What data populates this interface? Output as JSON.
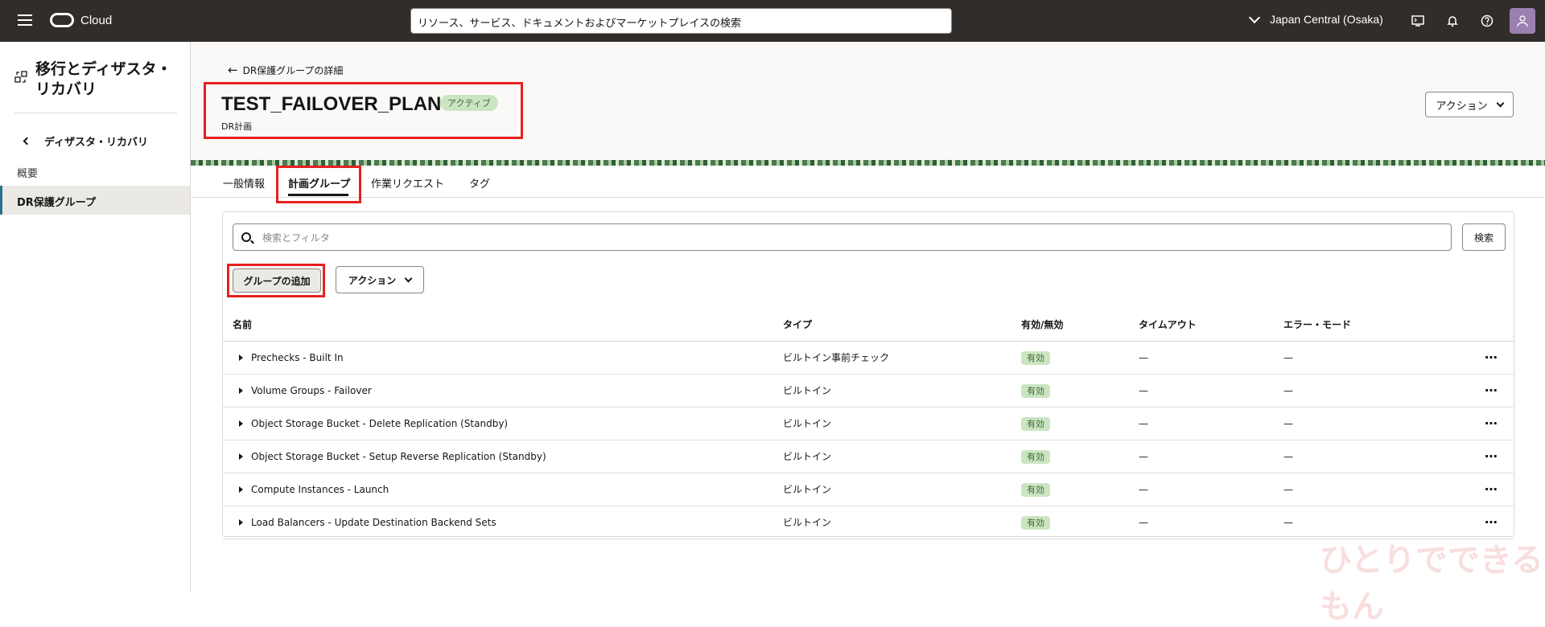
{
  "topbar": {
    "logo_text": "Cloud",
    "search_placeholder": "リソース、サービス、ドキュメントおよびマーケットプレイスの検索",
    "region": "Japan Central (Osaka)"
  },
  "sidebar": {
    "title": "移行とディザスタ・リカバリ",
    "back_label": "ディザスタ・リカバリ",
    "overview": "概要",
    "active_item": "DR保護グループ"
  },
  "header": {
    "back_link": "DR保護グループの詳細",
    "title": "TEST_FAILOVER_PLAN",
    "status": "アクティブ",
    "subtitle": "DR計画",
    "action_button": "アクション"
  },
  "tabs": [
    {
      "label": "一般情報"
    },
    {
      "label": "計画グループ"
    },
    {
      "label": "作業リクエスト"
    },
    {
      "label": "タグ"
    }
  ],
  "toolbar": {
    "filter_placeholder": "検索とフィルタ",
    "search_button": "検索",
    "add_group_button": "グループの追加",
    "action_button": "アクション"
  },
  "table": {
    "columns": [
      "名前",
      "タイプ",
      "有効/無効",
      "タイムアウト",
      "エラー・モード"
    ],
    "rows": [
      {
        "name": "Prechecks - Built In",
        "type": "ビルトイン事前チェック",
        "enabled": "有効",
        "timeout": "—",
        "error_mode": "—"
      },
      {
        "name": "Volume Groups - Failover",
        "type": "ビルトイン",
        "enabled": "有効",
        "timeout": "—",
        "error_mode": "—"
      },
      {
        "name": "Object Storage Bucket - Delete Replication (Standby)",
        "type": "ビルトイン",
        "enabled": "有効",
        "timeout": "—",
        "error_mode": "—"
      },
      {
        "name": "Object Storage Bucket - Setup Reverse Replication (Standby)",
        "type": "ビルトイン",
        "enabled": "有効",
        "timeout": "—",
        "error_mode": "—"
      },
      {
        "name": "Compute Instances - Launch",
        "type": "ビルトイン",
        "enabled": "有効",
        "timeout": "—",
        "error_mode": "—"
      },
      {
        "name": "Load Balancers - Update Destination Backend Sets",
        "type": "ビルトイン",
        "enabled": "有効",
        "timeout": "—",
        "error_mode": "—"
      }
    ]
  },
  "watermark": "ひとりでできるもん"
}
